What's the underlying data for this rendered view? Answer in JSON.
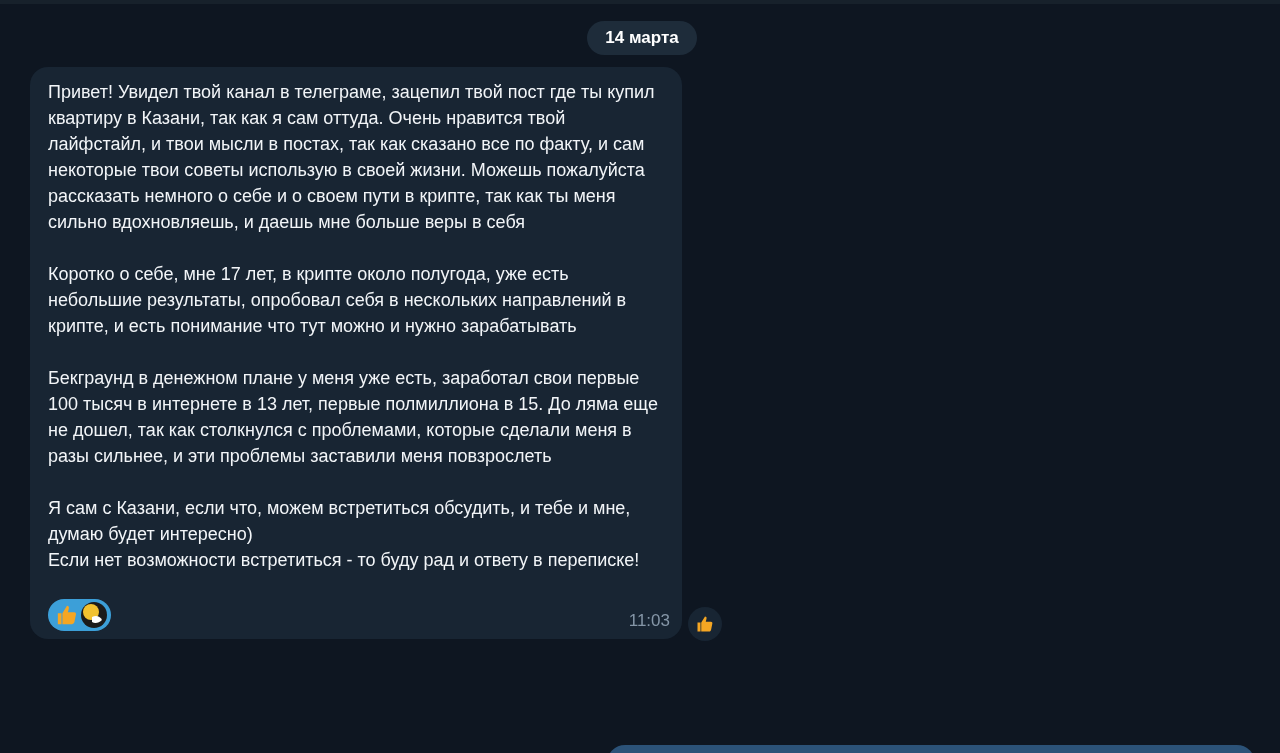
{
  "date_badge": "14 марта",
  "message": {
    "blocks": [
      [
        "Привет! Увидел твой канал в телеграме, зацепил твой пост где ты купил квартиру в Казани, так как я сам оттуда. Очень нравится твой лайфстайл, и твои мысли в постах, так как сказано все по факту, и сам некоторые твои советы использую в своей жизни. Можешь пожалуйста рассказать немного о себе и о своем пути в крипте, так как ты меня сильно вдохновляешь, и даешь мне больше веры в себя"
      ],
      [
        "Коротко о себе, мне 17 лет, в крипте около полугода, уже есть небольшие результаты, опробовал себя в нескольких направлений в крипте, и есть понимание что тут можно и нужно зарабатывать"
      ],
      [
        "Бекграунд в денежном плане у меня уже есть, заработал свои первые 100 тысяч в интернете в 13 лет, первые полмиллиона в 15. До ляма еще не дошел, так как столкнулся с проблемами, которые сделали меня в разы сильнее, и эти проблемы заставили меня повзрослеть"
      ],
      [
        "Я сам с Казани, если что, можем встретиться обсудить, и тебе и мне, думаю будет интересно)",
        "Если нет возможности встретиться - то буду рад и ответу в переписке!"
      ]
    ],
    "reactions": [
      {
        "kind": "thumbs",
        "selected": true
      }
    ],
    "time": "11:03"
  }
}
